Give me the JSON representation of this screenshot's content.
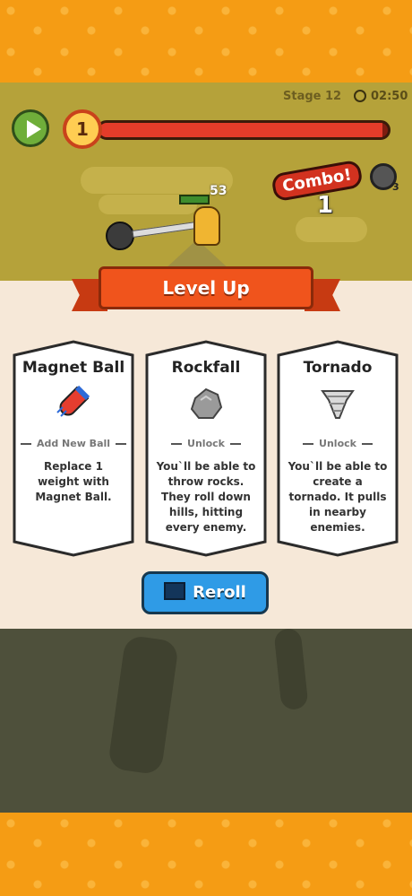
{
  "hud": {
    "stage_label": "Stage 12",
    "timer": "02:50",
    "level": "1",
    "xp_progress": 0.98,
    "combo_label": "Combo!",
    "combo_count": "1",
    "ball_count": "3",
    "player_hp": "53"
  },
  "level_up": {
    "title": "Level Up",
    "cards": [
      {
        "title": "Magnet Ball",
        "icon": "magnet-icon",
        "subtitle": "Add New Ball",
        "description": "Replace 1 weight with Magnet Ball."
      },
      {
        "title": "Rockfall",
        "icon": "rock-icon",
        "subtitle": "Unlock",
        "description": "You`ll be able to throw rocks. They roll down hills, hitting every enemy."
      },
      {
        "title": "Tornado",
        "icon": "tornado-icon",
        "subtitle": "Unlock",
        "description": "You`ll be able to create a tornado. It pulls in nearby enemies."
      }
    ],
    "reroll_label": "Reroll"
  },
  "colors": {
    "band_orange": "#f59c14",
    "ribbon_red": "#f0541c",
    "reroll_blue": "#2f9be6",
    "panel_bg": "#f6e8d8"
  }
}
